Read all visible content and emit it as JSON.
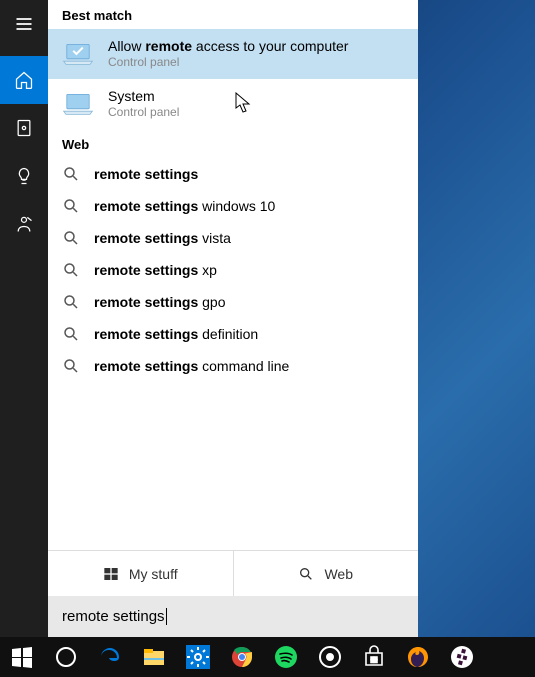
{
  "sections": {
    "best_match": "Best match",
    "web": "Web"
  },
  "results": [
    {
      "title_bold": "remote",
      "title_pre": "Allow ",
      "title_post": " access to your computer",
      "sub": "Control panel",
      "selected": true
    },
    {
      "title_bold": "",
      "title_pre": "System",
      "title_post": "",
      "sub": "Control panel",
      "selected": false
    }
  ],
  "web_suggestions": [
    {
      "bold": "remote settings",
      "rest": ""
    },
    {
      "bold": "remote settings",
      "rest": " windows 10"
    },
    {
      "bold": "remote settings",
      "rest": " vista"
    },
    {
      "bold": "remote settings",
      "rest": " xp"
    },
    {
      "bold": "remote settings",
      "rest": " gpo"
    },
    {
      "bold": "remote settings",
      "rest": " definition"
    },
    {
      "bold": "remote settings",
      "rest": " command line"
    }
  ],
  "filters": {
    "my_stuff": "My stuff",
    "web": "Web"
  },
  "search_query": "remote settings",
  "rail": [
    "menu",
    "home",
    "clock",
    "bulb",
    "person"
  ],
  "taskbar_apps": [
    "start",
    "cortana",
    "edge",
    "explorer",
    "settings",
    "chrome",
    "spotify",
    "media",
    "store",
    "firefox",
    "slack"
  ]
}
